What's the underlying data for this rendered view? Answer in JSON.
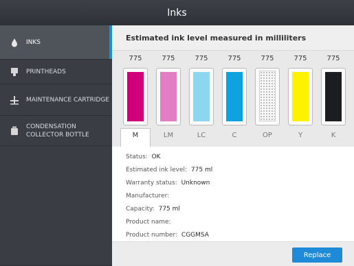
{
  "window": {
    "title": "Inks"
  },
  "sidebar": {
    "items": [
      {
        "label": "INKS",
        "icon": "ink-drop-icon"
      },
      {
        "label": "PRINTHEADS",
        "icon": "printhead-icon"
      },
      {
        "label": "MAINTENANCE CARTRIDGE",
        "icon": "maintenance-cartridge-icon"
      },
      {
        "label": "CONDENSATION COLLECTOR BOTTLE",
        "icon": "bottle-icon"
      }
    ],
    "selected": "INKS",
    "accent_color": "#1a8fd9"
  },
  "main": {
    "heading": "Estimated ink level measured in milliliters",
    "cartridges": [
      {
        "label": "M",
        "value": "775",
        "color": "#d1007a",
        "level": 1.0
      },
      {
        "label": "LM",
        "value": "775",
        "color": "#e47ec4",
        "level": 1.0
      },
      {
        "label": "LC",
        "value": "775",
        "color": "#8dd6f0",
        "level": 1.0
      },
      {
        "label": "C",
        "value": "775",
        "color": "#0ea3e0",
        "level": 1.0
      },
      {
        "label": "OP",
        "value": "775",
        "color": "#f4f4f4",
        "level": 1.0
      },
      {
        "label": "Y",
        "value": "775",
        "color": "#fff200",
        "level": 1.0
      },
      {
        "label": "K",
        "value": "775",
        "color": "#1b1d20",
        "level": 1.0
      }
    ],
    "selected_cartridge": "M",
    "details": {
      "status": {
        "label": "Status:",
        "value": "OK"
      },
      "level": {
        "label": "Estimated ink level:",
        "value": "775 ml"
      },
      "warranty": {
        "label": "Warranty status:",
        "value": "Unknown"
      },
      "manufacturer": {
        "label": "Manufacturer:",
        "value": ""
      },
      "capacity": {
        "label": "Capacity:",
        "value": "775 ml"
      },
      "product_name": {
        "label": "Product name:",
        "value": ""
      },
      "product_number": {
        "label": "Product number:",
        "value": "CGGMSA"
      }
    },
    "replace_label": "Replace",
    "button_color": "#1f8ad7"
  }
}
